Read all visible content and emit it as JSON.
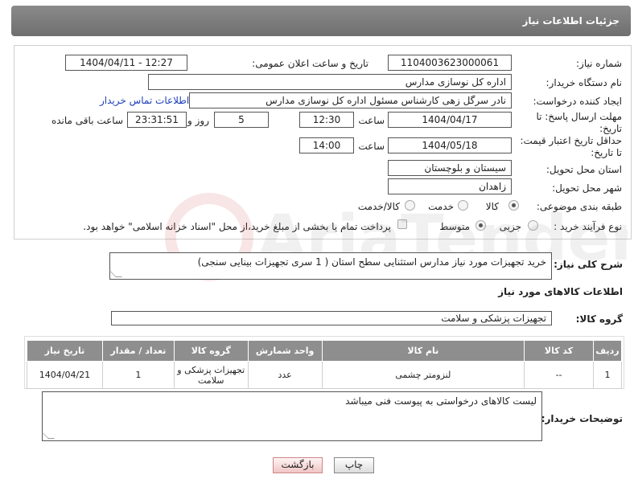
{
  "header": {
    "title": "جزئیات اطلاعات نیاز"
  },
  "labels": {
    "need_number": "شماره نیاز:",
    "announce_datetime": "تاریخ و ساعت اعلان عمومی:",
    "buyer_org": "نام دستگاه خریدار:",
    "requester": "ایجاد کننده درخواست:",
    "reply_deadline": "مهلت ارسال پاسخ: تا تاریخ:",
    "price_validity": "حداقل تاریخ اعتبار قیمت: تا تاریخ:",
    "delivery_province": "استان محل تحویل:",
    "delivery_city": "شهر محل تحویل:",
    "category": "طبقه بندی موضوعی:",
    "purchase_type": "نوع فرآیند خرید :",
    "time": "ساعت",
    "day_and": "روز و",
    "remaining": "ساعت باقی مانده"
  },
  "values": {
    "need_number": "1104003623000061",
    "announce_datetime": "1404/04/11 - 12:27",
    "buyer_org": "اداره کل نوسازی مدارس",
    "requester": "نادر سرگل زهی کارشناس مسئول اداره کل نوسازی مدارس",
    "contact_link": "اطلاعات تماس خریدار",
    "reply_date": "1404/04/17",
    "reply_time": "12:30",
    "reply_days": "5",
    "reply_remaining": "23:31:51",
    "price_date": "1404/05/18",
    "price_time": "14:00",
    "province": "سیستان و بلوچستان",
    "city": "زاهدان"
  },
  "category_options": [
    {
      "label": "کالا",
      "selected": true
    },
    {
      "label": "خدمت",
      "selected": false
    },
    {
      "label": "کالا/خدمت",
      "selected": false
    }
  ],
  "purchase_options": [
    {
      "label": "جزیی",
      "selected": false
    },
    {
      "label": "متوسط",
      "selected": true
    }
  ],
  "payment_note": "پرداخت تمام یا بخشی از مبلغ خرید،از محل \"اسناد خزانه اسلامی\" خواهد بود.",
  "description": {
    "label": "شرح کلی نیاز:",
    "text": "خرید تجهیزات مورد نیاز مدارس استثنایی سطح استان ( 1 سری تجهیزات بینایی سنجی)"
  },
  "goods_section": {
    "title": "اطلاعات کالاهای مورد نیاز",
    "group_label": "گروه کالا:",
    "group_value": "تجهیزات پزشکی و سلامت"
  },
  "table": {
    "headers": [
      "ردیف",
      "کد کالا",
      "نام کالا",
      "واحد شمارش",
      "گروه کالا",
      "تعداد / مقدار",
      "تاریخ نیاز"
    ],
    "rows": [
      [
        "1",
        "--",
        "لنزومتر چشمی",
        "عدد",
        "تجهیزات پزشکی و سلامت",
        "1",
        "1404/04/21"
      ]
    ]
  },
  "buyer_notes": {
    "label": "توضیحات خریدار:",
    "text": "لیست کالاهای درخواستی به پیوست فنی میباشد"
  },
  "buttons": {
    "print": "چاپ",
    "back": "بازگشت"
  },
  "watermark": {
    "text": "AriaTender.net"
  },
  "colors": {
    "header": "#7c7c7c",
    "link": "#1d3fb8",
    "table_header": "#8e8e8e"
  }
}
